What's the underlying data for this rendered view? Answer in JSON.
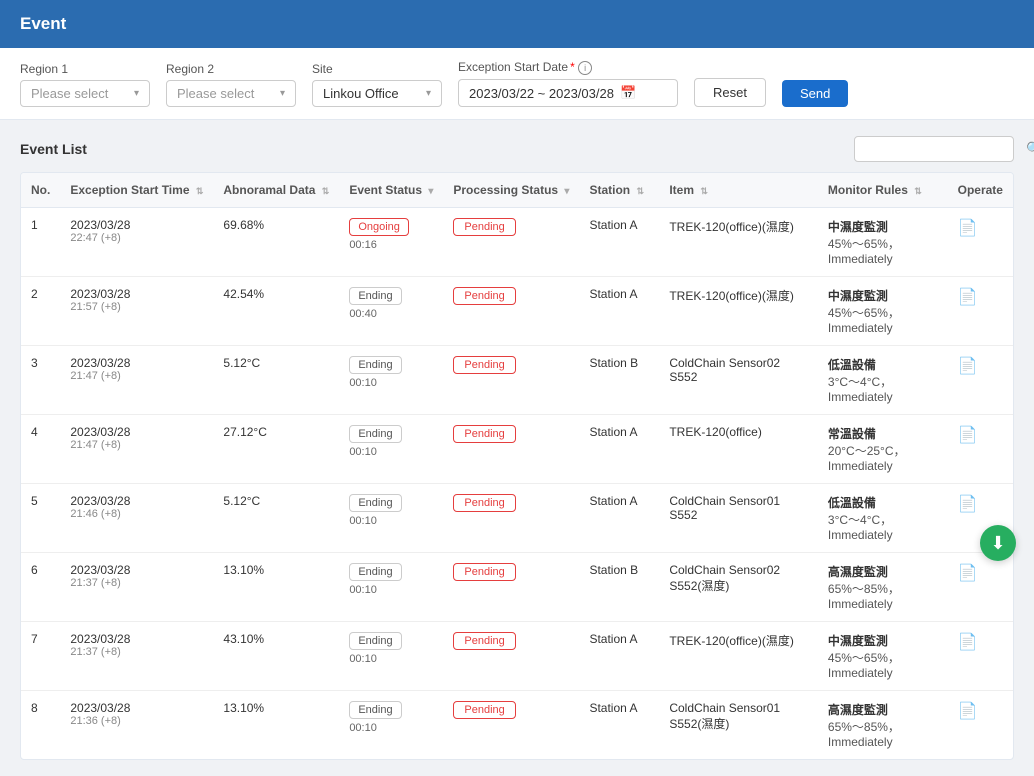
{
  "header": {
    "title": "Event"
  },
  "filters": {
    "region1_label": "Region 1",
    "region1_placeholder": "Please select",
    "region2_label": "Region 2",
    "region2_placeholder": "Please select",
    "site_label": "Site",
    "site_value": "Linkou Office",
    "exception_date_label": "Exception Start Date",
    "exception_date_value": "2023/03/22 ~ 2023/03/28",
    "reset_label": "Reset",
    "send_label": "Send"
  },
  "event_list": {
    "title": "Event List",
    "search_placeholder": "Search",
    "columns": {
      "no": "No.",
      "exception_start_time": "Exception Start Time",
      "abnormal_data": "Abnoramal Data",
      "event_status": "Event Status",
      "processing_status": "Processing Status",
      "station": "Station",
      "item": "Item",
      "monitor_rules": "Monitor Rules",
      "operate": "Operate"
    },
    "rows": [
      {
        "no": 1,
        "start_time": "2023/03/28",
        "start_time2": "22:47 (+8)",
        "abnormal_data": "69.68%",
        "event_status": "Ongoing",
        "event_status_type": "ongoing",
        "event_time": "00:16",
        "processing_status": "Pending",
        "station": "Station A",
        "item": "TREK-120(office)(濕度)",
        "monitor_rules": "中濕度監測",
        "monitor_rules2": "45%～65%，",
        "monitor_rules3": "Immediately"
      },
      {
        "no": 2,
        "start_time": "2023/03/28",
        "start_time2": "21:57 (+8)",
        "abnormal_data": "42.54%",
        "event_status": "Ending",
        "event_status_type": "ending",
        "event_time": "00:40",
        "processing_status": "Pending",
        "station": "Station A",
        "item": "TREK-120(office)(濕度)",
        "monitor_rules": "中濕度監測",
        "monitor_rules2": "45%～65%，",
        "monitor_rules3": "Immediately"
      },
      {
        "no": 3,
        "start_time": "2023/03/28",
        "start_time2": "21:47 (+8)",
        "abnormal_data": "5.12°C",
        "event_status": "Ending",
        "event_status_type": "ending",
        "event_time": "00:10",
        "processing_status": "Pending",
        "station": "Station B",
        "item": "ColdChain Sensor02 S552",
        "monitor_rules": "低溫設備",
        "monitor_rules2": "3°C～4°C，",
        "monitor_rules3": "Immediately"
      },
      {
        "no": 4,
        "start_time": "2023/03/28",
        "start_time2": "21:47 (+8)",
        "abnormal_data": "27.12°C",
        "event_status": "Ending",
        "event_status_type": "ending",
        "event_time": "00:10",
        "processing_status": "Pending",
        "station": "Station A",
        "item": "TREK-120(office)",
        "monitor_rules": "常溫設備",
        "monitor_rules2": "20°C～25°C，",
        "monitor_rules3": "Immediately"
      },
      {
        "no": 5,
        "start_time": "2023/03/28",
        "start_time2": "21:46 (+8)",
        "abnormal_data": "5.12°C",
        "event_status": "Ending",
        "event_status_type": "ending",
        "event_time": "00:10",
        "processing_status": "Pending",
        "station": "Station A",
        "item": "ColdChain Sensor01 S552",
        "monitor_rules": "低溫設備",
        "monitor_rules2": "3°C～4°C，",
        "monitor_rules3": "Immediately"
      },
      {
        "no": 6,
        "start_time": "2023/03/28",
        "start_time2": "21:37 (+8)",
        "abnormal_data": "13.10%",
        "event_status": "Ending",
        "event_status_type": "ending",
        "event_time": "00:10",
        "processing_status": "Pending",
        "station": "Station B",
        "item": "ColdChain Sensor02 S552(濕度)",
        "monitor_rules": "高濕度監測",
        "monitor_rules2": "65%～85%，",
        "monitor_rules3": "Immediately"
      },
      {
        "no": 7,
        "start_time": "2023/03/28",
        "start_time2": "21:37 (+8)",
        "abnormal_data": "43.10%",
        "event_status": "Ending",
        "event_status_type": "ending",
        "event_time": "00:10",
        "processing_status": "Pending",
        "station": "Station A",
        "item": "TREK-120(office)(濕度)",
        "monitor_rules": "中濕度監測",
        "monitor_rules2": "45%～65%，",
        "monitor_rules3": "Immediately"
      },
      {
        "no": 8,
        "start_time": "2023/03/28",
        "start_time2": "21:36 (+8)",
        "abnormal_data": "13.10%",
        "event_status": "Ending",
        "event_status_type": "ending",
        "event_time": "00:10",
        "processing_status": "Pending",
        "station": "Station A",
        "item": "ColdChain Sensor01 S552(濕度)",
        "monitor_rules": "高濕度監測",
        "monitor_rules2": "65%～85%，",
        "monitor_rules3": "Immediately"
      }
    ]
  }
}
